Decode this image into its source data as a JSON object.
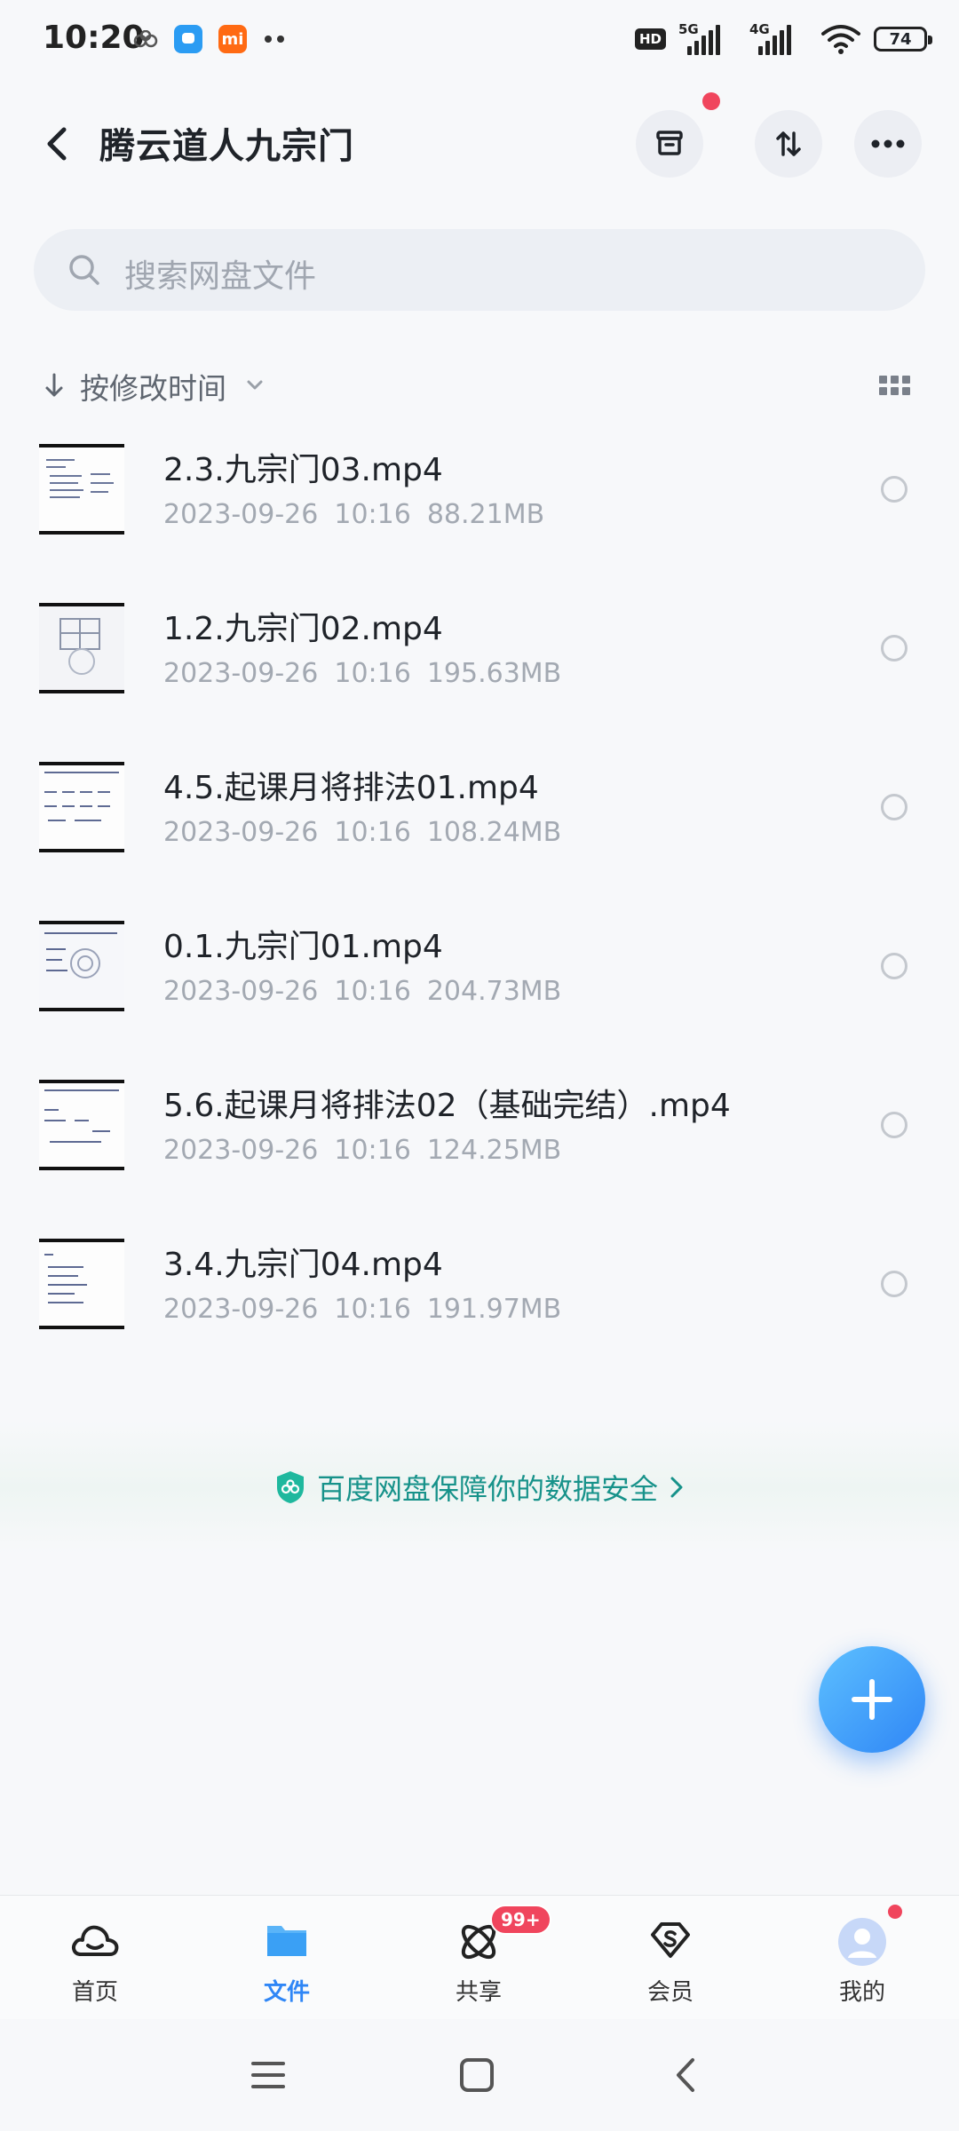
{
  "status_bar": {
    "time": "10:20",
    "network_1": "5G",
    "network_2": "4G",
    "hd_label": "HD",
    "battery": "74",
    "mi_label": "mi"
  },
  "header": {
    "title": "腾云道人九宗门"
  },
  "search": {
    "placeholder": "搜索网盘文件"
  },
  "sort": {
    "label": "按修改时间"
  },
  "files": [
    {
      "name": "2.3.九宗门03.mp4",
      "date": "2023-09-26",
      "time": "10:16",
      "size": "88.21MB"
    },
    {
      "name": "1.2.九宗门02.mp4",
      "date": "2023-09-26",
      "time": "10:16",
      "size": "195.63MB"
    },
    {
      "name": "4.5.起课月将排法01.mp4",
      "date": "2023-09-26",
      "time": "10:16",
      "size": "108.24MB"
    },
    {
      "name": "0.1.九宗门01.mp4",
      "date": "2023-09-26",
      "time": "10:16",
      "size": "204.73MB"
    },
    {
      "name": "5.6.起课月将排法02（基础完结）.mp4",
      "date": "2023-09-26",
      "time": "10:16",
      "size": "124.25MB"
    },
    {
      "name": "3.4.九宗门04.mp4",
      "date": "2023-09-26",
      "time": "10:16",
      "size": "191.97MB"
    }
  ],
  "banner": {
    "text": "百度网盘保障你的数据安全"
  },
  "tabs": [
    {
      "label": "首页"
    },
    {
      "label": "文件"
    },
    {
      "label": "共享",
      "badge": "99+"
    },
    {
      "label": "会员"
    },
    {
      "label": "我的"
    }
  ],
  "colors": {
    "accent": "#2f86f6",
    "badge_red": "#f0455d",
    "banner_green": "#17928a"
  }
}
